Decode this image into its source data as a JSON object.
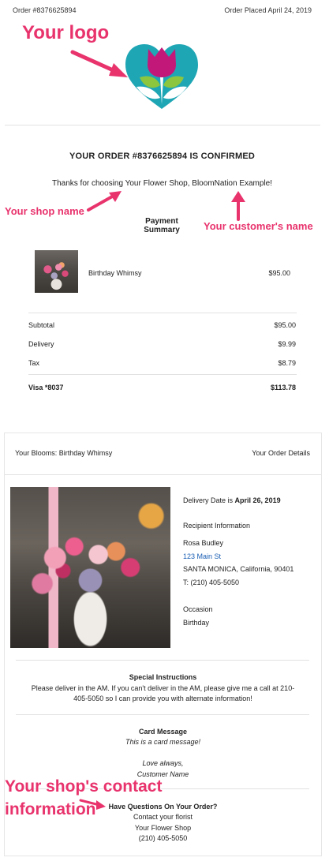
{
  "header": {
    "order_number": "Order #8376625894",
    "order_placed": "Order Placed April 24, 2019"
  },
  "annotations": {
    "logo": "Your logo",
    "shop_name": "Your shop name",
    "customer_name": "Your customer's  name",
    "contact_line1": "Your shop's contact",
    "contact_line2": "information"
  },
  "confirmation": {
    "title": "YOUR ORDER #8376625894 IS CONFIRMED",
    "thanks": "Thanks for choosing Your Flower Shop, BloomNation Example!",
    "payment_heading": "Payment Summary"
  },
  "line_item": {
    "name": "Birthday Whimsy",
    "price": "$95.00"
  },
  "totals": [
    {
      "label": "Subtotal",
      "value": "$95.00"
    },
    {
      "label": "Delivery",
      "value": "$9.99"
    },
    {
      "label": "Tax",
      "value": "$8.79"
    }
  ],
  "payment": {
    "method": "Visa *8037",
    "total": "$113.78"
  },
  "details": {
    "blooms_title": "Your Blooms: Birthday Whimsy",
    "order_details_link": "Your Order Details",
    "delivery_date_label": "Delivery Date is",
    "delivery_date": "April 26, 2019",
    "recipient_heading": "Recipient Information",
    "recipient_name": "Rosa Budley",
    "recipient_street": "123 Main St",
    "recipient_city": "SANTA MONICA, California, 90401",
    "recipient_phone": "T: (210) 405-5050",
    "occasion_heading": "Occasion",
    "occasion": "Birthday"
  },
  "special": {
    "heading": "Special Instructions",
    "line1": "Please deliver in the AM. If you can't deliver in the AM, please give me a call at 210-",
    "line2": "405-5050 so I can provide you with alternate information!"
  },
  "card_message": {
    "heading": "Card Message",
    "text": "This is a card message!",
    "closing": "Love always,",
    "signature": "Customer Name"
  },
  "contact": {
    "heading": "Have Questions On Your Order?",
    "line1": "Contact your florist",
    "shop": "Your Flower Shop",
    "phone": "(210) 405-5050"
  },
  "colors": {
    "annotation": "#e8336d",
    "logo_magenta": "#c2187a",
    "logo_teal": "#1fa6b5",
    "logo_green": "#8cc63f",
    "link": "#1a5fb4"
  }
}
